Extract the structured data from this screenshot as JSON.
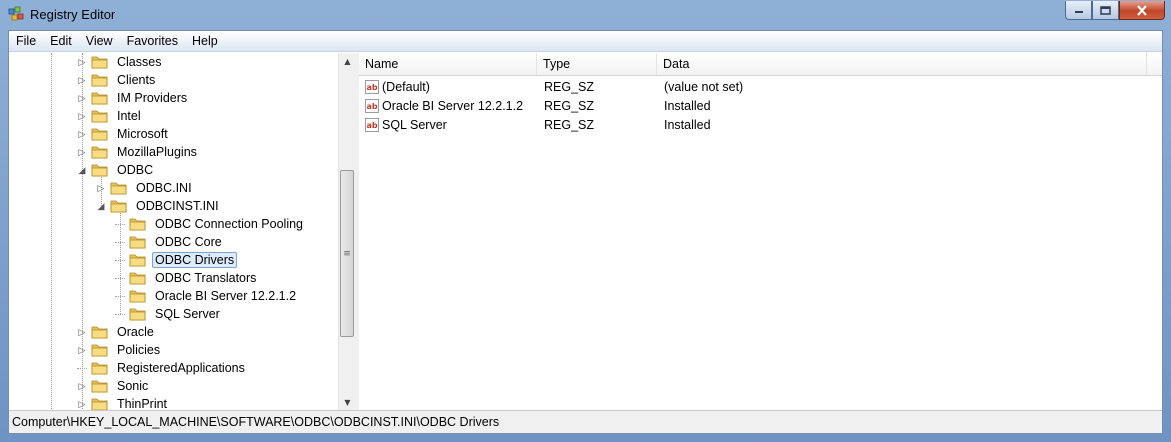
{
  "window": {
    "title": "Registry Editor"
  },
  "menu": [
    "File",
    "Edit",
    "View",
    "Favorites",
    "Help"
  ],
  "tree": [
    {
      "label": "Classes",
      "level": 0,
      "state": "collapsed"
    },
    {
      "label": "Clients",
      "level": 0,
      "state": "collapsed"
    },
    {
      "label": "IM Providers",
      "level": 0,
      "state": "collapsed"
    },
    {
      "label": "Intel",
      "level": 0,
      "state": "collapsed"
    },
    {
      "label": "Microsoft",
      "level": 0,
      "state": "collapsed"
    },
    {
      "label": "MozillaPlugins",
      "level": 0,
      "state": "collapsed"
    },
    {
      "label": "ODBC",
      "level": 0,
      "state": "expanded"
    },
    {
      "label": "ODBC.INI",
      "level": 1,
      "state": "collapsed"
    },
    {
      "label": "ODBCINST.INI",
      "level": 1,
      "state": "expanded"
    },
    {
      "label": "ODBC Connection Pooling",
      "level": 2,
      "state": "leaf"
    },
    {
      "label": "ODBC Core",
      "level": 2,
      "state": "leaf"
    },
    {
      "label": "ODBC Drivers",
      "level": 2,
      "state": "leaf",
      "selected": true
    },
    {
      "label": "ODBC Translators",
      "level": 2,
      "state": "leaf"
    },
    {
      "label": "Oracle BI Server 12.2.1.2",
      "level": 2,
      "state": "leaf"
    },
    {
      "label": "SQL Server",
      "level": 2,
      "state": "leaf"
    },
    {
      "label": "Oracle",
      "level": 0,
      "state": "collapsed"
    },
    {
      "label": "Policies",
      "level": 0,
      "state": "collapsed"
    },
    {
      "label": "RegisteredApplications",
      "level": 0,
      "state": "leaf"
    },
    {
      "label": "Sonic",
      "level": 0,
      "state": "collapsed"
    },
    {
      "label": "ThinPrint",
      "level": 0,
      "state": "collapsed"
    }
  ],
  "list": {
    "columns": [
      "Name",
      "Type",
      "Data"
    ],
    "rows": [
      {
        "name": "(Default)",
        "type": "REG_SZ",
        "data": "(value not set)",
        "icon": "string-value-icon"
      },
      {
        "name": "Oracle BI Server 12.2.1.2",
        "type": "REG_SZ",
        "data": "Installed",
        "icon": "string-value-icon"
      },
      {
        "name": "SQL Server",
        "type": "REG_SZ",
        "data": "Installed",
        "icon": "string-value-icon"
      }
    ]
  },
  "status": {
    "path": "Computer\\HKEY_LOCAL_MACHINE\\SOFTWARE\\ODBC\\ODBCINST.INI\\ODBC Drivers"
  },
  "icons": {
    "app": "registry-editor-icon",
    "tree_node": "folder-icon",
    "value": "string-value-icon",
    "minimize": "minimize-icon",
    "maximize": "maximize-icon",
    "close": "close-icon"
  },
  "colors": {
    "selection": "#dcecfc",
    "selection_border": "#7da2ce",
    "titlebar": "#8fb0d6"
  }
}
